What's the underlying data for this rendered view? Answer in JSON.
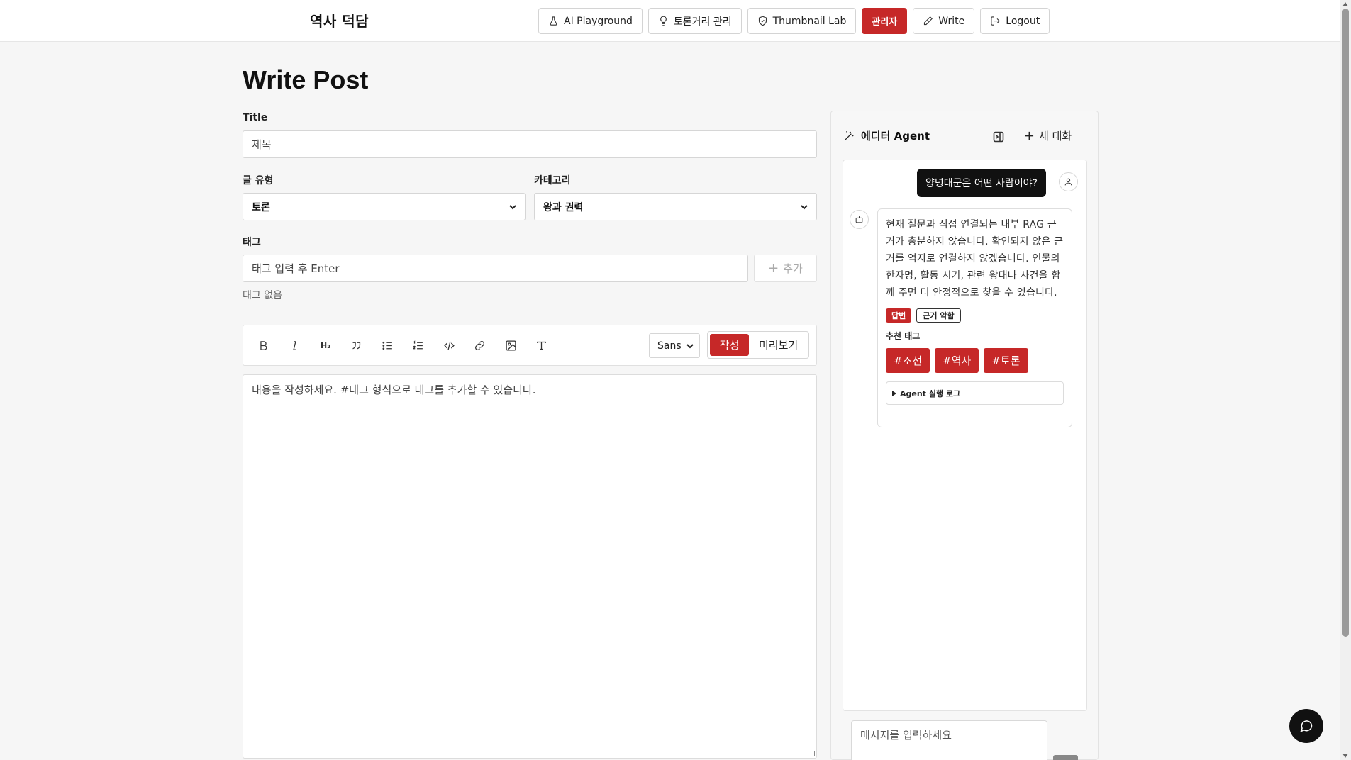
{
  "header": {
    "logo": "역사 덕담",
    "nav": [
      {
        "label": "AI Playground",
        "icon": "flask-icon"
      },
      {
        "label": "토론거리 관리",
        "icon": "lightbulb-icon"
      },
      {
        "label": "Thumbnail Lab",
        "icon": "shield-icon"
      },
      {
        "label": "관리자",
        "icon": ""
      },
      {
        "label": "Write",
        "icon": "pencil-icon"
      },
      {
        "label": "Logout",
        "icon": "logout-icon"
      }
    ]
  },
  "form": {
    "page_title": "Write Post",
    "title_label": "Title",
    "title_placeholder": "제목",
    "post_type_label": "글 유형",
    "post_type_value": "토론",
    "category_label": "카테고리",
    "category_value": "왕과 권력",
    "tags_label": "태그",
    "tag_input_placeholder": "태그 입력 후 Enter",
    "add_tag_label": "추가",
    "no_tags": "태그 없음",
    "font_value": "Sans",
    "mode_write": "작성",
    "mode_preview": "미리보기",
    "content_placeholder": "내용을 작성하세요. #태그 형식으로 태그를 추가할 수 있습니다.",
    "toolbar_icons": [
      "bold-icon",
      "italic-icon",
      "heading-icon",
      "quote-icon",
      "bullet-list-icon",
      "numbered-list-icon",
      "code-icon",
      "link-icon",
      "image-icon",
      "text-format-icon"
    ],
    "heading_glyph": "H₂"
  },
  "agent": {
    "title": "에디터 Agent",
    "new_chat": "새 대화",
    "user_message": "양녕대군은 어떤 사람이야?",
    "bot_message": "현재 질문과 직접 연결되는 내부 RAG 근거가 충분하지 않습니다. 확인되지 않은 근거를 억지로 연결하지 않겠습니다. 인물의 한자명, 활동 시기, 관련 왕대나 사건을 함께 주면 더 안정적으로 찾을 수 있습니다.",
    "badge_answer": "답변",
    "badge_weak": "근거 약함",
    "recommended_label": "추천 태그",
    "recommended_tags": [
      "#조선",
      "#역사",
      "#토론"
    ],
    "log_label": "Agent 실행 로그",
    "message_placeholder": "메시지를 입력하세요"
  },
  "colors": {
    "accent": "#c62828",
    "dark": "#111111"
  }
}
